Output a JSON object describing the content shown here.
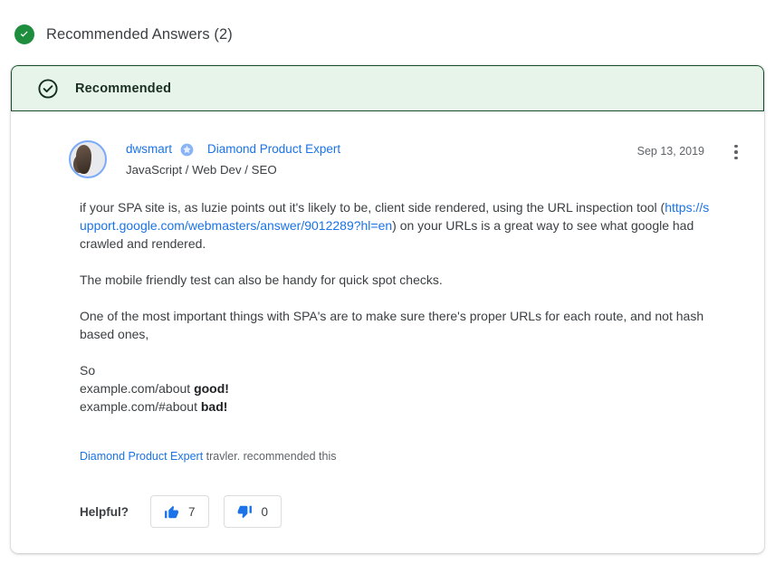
{
  "section": {
    "title": "Recommended Answers (2)",
    "icon": "check-circle-icon",
    "accent_color": "#1e8e3e"
  },
  "card": {
    "banner": {
      "label": "Recommended",
      "icon": "check-circle-outline-icon",
      "background": "#e6f4ea",
      "border_color": "#174d2b"
    },
    "author": {
      "avatar_icon": "user-avatar",
      "name": "dwsmart",
      "badge_icon": "diamond-product-expert-star-icon",
      "expert_label": "Diamond Product Expert",
      "subtitle": "JavaScript / Web Dev / SEO",
      "date": "Sep 13, 2019",
      "menu_icon": "more-vertical-icon",
      "link_color": "#1a73e8"
    },
    "message": {
      "p1_before_link": "if your SPA site is, as luzie points out it's likely to be, client side rendered, using the URL inspection tool (",
      "p1_link": "https://support.google.com/webmasters/answer/9012289?hl=en",
      "p1_after_link": ") on your URLs is a great way to see what google had crawled and rendered.",
      "p2": "The mobile friendly test can also be handy for quick spot checks.",
      "p3": "One of the most important things with SPA's are to make sure there's proper URLs for each route, and not hash based ones,",
      "p4_line1": "So",
      "p4_line2_plain": "example.com/about ",
      "p4_line2_bold": "good!",
      "p4_line3_plain": "example.com/#about ",
      "p4_line3_bold": "bad!"
    },
    "recommended_by": {
      "expert_link": "Diamond Product Expert",
      "rest": " travler. recommended this"
    },
    "helpful": {
      "label": "Helpful?",
      "thumbs_up_icon": "thumb-up-icon",
      "thumbs_up_count": "7",
      "thumbs_down_icon": "thumb-down-icon",
      "thumbs_down_count": "0",
      "icon_color": "#1a73e8"
    }
  }
}
